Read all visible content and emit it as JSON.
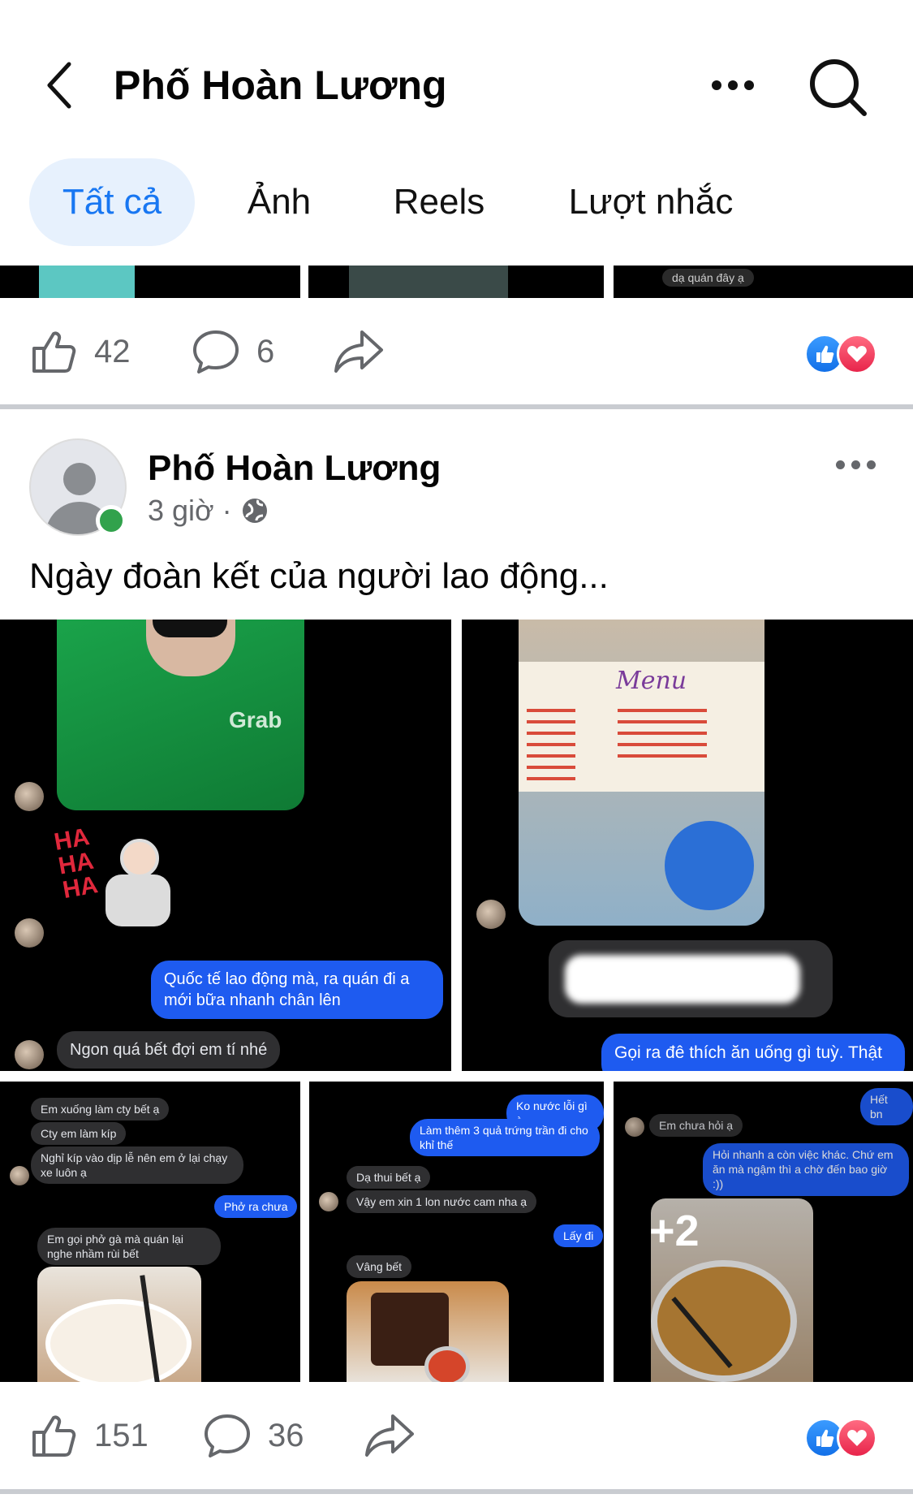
{
  "header": {
    "title": "Phố Hoàn Lương"
  },
  "tabs": [
    {
      "label": "Tất cả",
      "active": true
    },
    {
      "label": "Ảnh",
      "active": false
    },
    {
      "label": "Reels",
      "active": false
    },
    {
      "label": "Lượt nhắc",
      "active": false
    }
  ],
  "prev_post": {
    "strip_caption": "dạ quán đây ạ",
    "likes": "42",
    "comments": "6"
  },
  "post": {
    "author": "Phố Hoàn Lương",
    "time": "3 giờ",
    "separator": "·",
    "text": "Ngày đoàn kết của người lao động...",
    "likes": "151",
    "comments": "36",
    "more_photos": "+2",
    "photo1": {
      "msg_blue": "Quốc tế lao động mà, ra quán đi a mới bữa nhanh chân lên",
      "msg_gray": "Ngon quá bết đợi em tí nhé",
      "sticker_text": "HA HA HA"
    },
    "photo2": {
      "menu_title": "Menu",
      "msg_blue": "Gọi ra đê thích ăn uống gì tuỳ. Thật"
    },
    "photo3": {
      "msgs": [
        "Em xuống làm cty bết ạ",
        "Cty em làm kíp",
        "Nghỉ kíp vào dịp lễ nên em ở lại chạy xe luôn ạ",
        "Phở ra chưa",
        "Em gọi phở gà mà quán lại nghe nhầm rùi bết"
      ]
    },
    "photo4": {
      "msgs": [
        "Ko nước lỗi gì à",
        "Làm thêm 3 quả trứng trần đi cho khỉ thế",
        "Dạ thui bết ạ",
        "Vậy em xin 1 lon nước cam nha ạ",
        "Lấy đi",
        "Vâng bết"
      ]
    },
    "photo5": {
      "msgs": [
        "Hết bn",
        "Em chưa hỏi ạ",
        "Hỏi nhanh a còn việc khác. Chứ em ăn mà ngậm thì a chờ đến bao giờ :))"
      ]
    }
  },
  "colors": {
    "accent": "#1877f2",
    "muted": "#65676b",
    "online": "#31a24c",
    "messenger_blue": "#1e5bf0"
  }
}
